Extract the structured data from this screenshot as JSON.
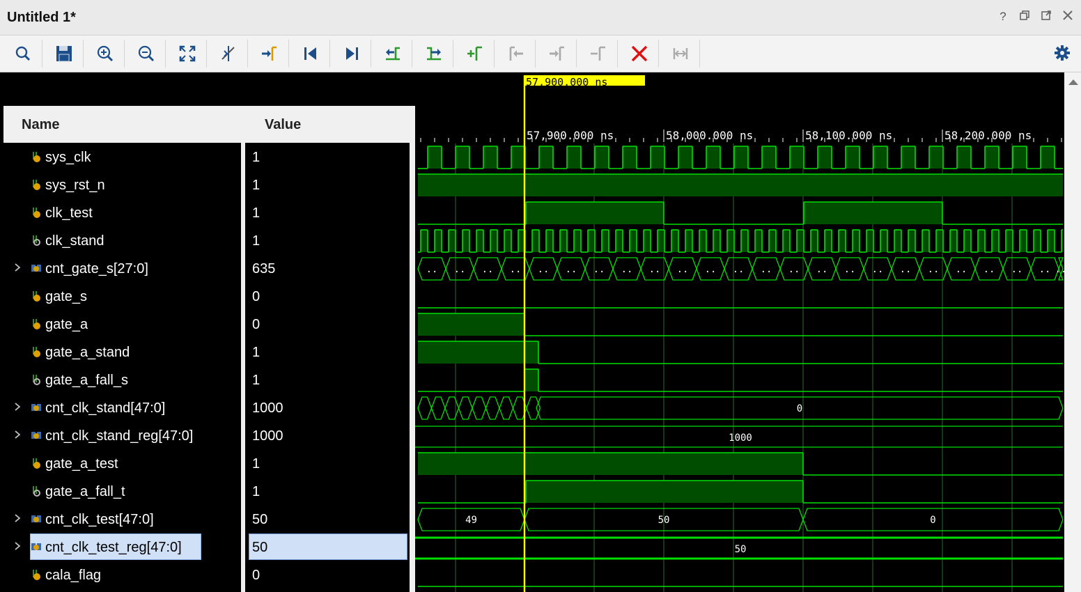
{
  "window": {
    "title": "Untitled 1*",
    "controls": [
      {
        "name": "help-icon",
        "glyph": "?"
      },
      {
        "name": "restore-icon",
        "glyph": "⧉"
      },
      {
        "name": "float-icon",
        "glyph": "⇱"
      },
      {
        "name": "close-icon",
        "glyph": "✕"
      }
    ]
  },
  "toolbar": {
    "buttons": [
      {
        "name": "search-icon"
      },
      {
        "name": "save-icon"
      },
      {
        "name": "zoom-in-icon"
      },
      {
        "name": "zoom-out-icon"
      },
      {
        "name": "zoom-fit-icon"
      },
      {
        "name": "cursor-to-zoom-icon"
      },
      {
        "name": "go-to-cursor-icon"
      },
      {
        "name": "go-to-time-0-icon"
      },
      {
        "name": "go-to-last-time-icon"
      },
      {
        "name": "previous-transition-icon"
      },
      {
        "name": "next-transition-icon"
      },
      {
        "name": "add-marker-icon"
      },
      {
        "name": "previous-marker-icon"
      },
      {
        "name": "next-marker-icon"
      },
      {
        "name": "swap-cursors-icon"
      },
      {
        "name": "delete-marker-icon"
      },
      {
        "name": "snap-to-transition-icon"
      }
    ],
    "settings": "gear-icon"
  },
  "columns": {
    "name": "Name",
    "value": "Value"
  },
  "cursor": {
    "label": "57,900.000 ns"
  },
  "timeline": {
    "ticks": [
      "57,900.000 ns",
      "58,000.000 ns",
      "58,100.000 ns",
      "58,200.000 ns"
    ]
  },
  "signals": [
    {
      "name": "sys_clk",
      "value": "1",
      "expandable": false,
      "icon": "logic"
    },
    {
      "name": "sys_rst_n",
      "value": "1",
      "expandable": false,
      "icon": "logic"
    },
    {
      "name": "clk_test",
      "value": "1",
      "expandable": false,
      "icon": "logic"
    },
    {
      "name": "clk_stand",
      "value": "1",
      "expandable": false,
      "icon": "logic-o"
    },
    {
      "name": "cnt_gate_s[27:0]",
      "value": "635",
      "expandable": true,
      "icon": "bus"
    },
    {
      "name": "gate_s",
      "value": "0",
      "expandable": false,
      "icon": "logic"
    },
    {
      "name": "gate_a",
      "value": "0",
      "expandable": false,
      "icon": "logic"
    },
    {
      "name": "gate_a_stand",
      "value": "1",
      "expandable": false,
      "icon": "logic"
    },
    {
      "name": "gate_a_fall_s",
      "value": "1",
      "expandable": false,
      "icon": "logic-o"
    },
    {
      "name": "cnt_clk_stand[47:0]",
      "value": "1000",
      "expandable": true,
      "icon": "bus"
    },
    {
      "name": "cnt_clk_stand_reg[47:0]",
      "value": "1000",
      "expandable": true,
      "icon": "bus"
    },
    {
      "name": "gate_a_test",
      "value": "1",
      "expandable": false,
      "icon": "logic"
    },
    {
      "name": "gate_a_fall_t",
      "value": "1",
      "expandable": false,
      "icon": "logic-o"
    },
    {
      "name": "cnt_clk_test[47:0]",
      "value": "50",
      "expandable": true,
      "icon": "bus"
    },
    {
      "name": "cnt_clk_test_reg[47:0]",
      "value": "50",
      "expandable": true,
      "icon": "bus-o",
      "selected": true
    },
    {
      "name": "cala_flag",
      "value": "0",
      "expandable": false,
      "icon": "logic"
    }
  ],
  "bus_labels": {
    "cnt_gate_s": "..",
    "cnt_clk_stand_after": "0",
    "cnt_clk_stand_reg": "1000",
    "cnt_clk_test_a": "49",
    "cnt_clk_test_b": "50",
    "cnt_clk_test_c": "0",
    "cnt_clk_test_reg": "50"
  },
  "colors": {
    "wave": "#00e000",
    "fill": "#004d00",
    "cursor": "#ffff00",
    "grid": "#2a6b2a",
    "selection": "#cfe0f7"
  }
}
